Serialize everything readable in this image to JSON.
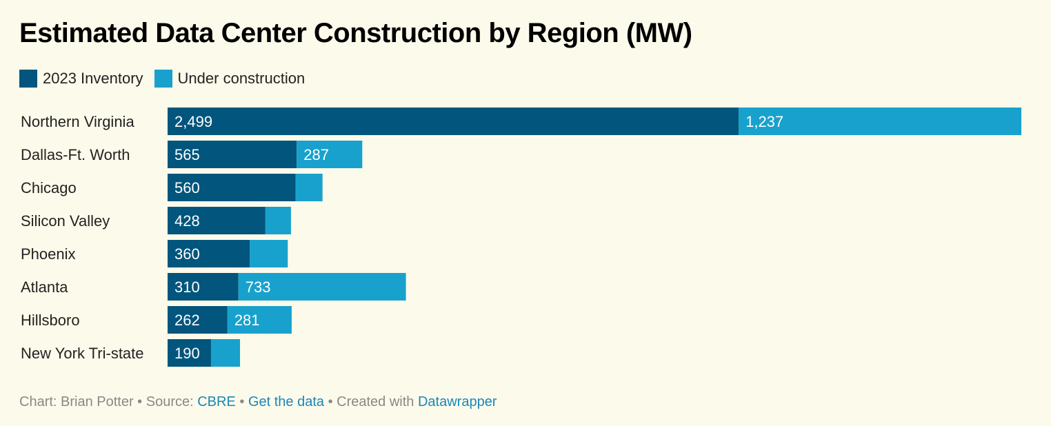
{
  "chart_data": {
    "type": "bar",
    "orientation": "horizontal",
    "stacked": true,
    "title": "Estimated Data Center Construction by Region (MW)",
    "categories": [
      "Northern Virginia",
      "Dallas-Ft. Worth",
      "Chicago",
      "Silicon Valley",
      "Phoenix",
      "Atlanta",
      "Hillsboro",
      "New York Tri-state"
    ],
    "series": [
      {
        "name": "2023 Inventory",
        "color": "#02557c",
        "values": [
          2499,
          565,
          560,
          428,
          360,
          310,
          262,
          190
        ],
        "labels": [
          "2,499",
          "565",
          "560",
          "428",
          "360",
          "310",
          "262",
          "190"
        ]
      },
      {
        "name": "Under construction",
        "color": "#18a1cd",
        "values": [
          1237,
          287,
          118,
          112,
          166,
          733,
          281,
          127
        ],
        "labels": [
          "1,237",
          "287",
          "",
          "",
          "",
          "733",
          "281",
          ""
        ]
      }
    ],
    "xlabel": "",
    "ylabel": "",
    "xlim": [
      0,
      3736
    ],
    "grid": false,
    "legend": "top-left"
  },
  "footer": {
    "prefix": "Chart: Brian Potter • Source: ",
    "source": "CBRE",
    "sep1": " • ",
    "get_data": "Get the data",
    "sep2": " • Created with ",
    "tool": "Datawrapper"
  }
}
